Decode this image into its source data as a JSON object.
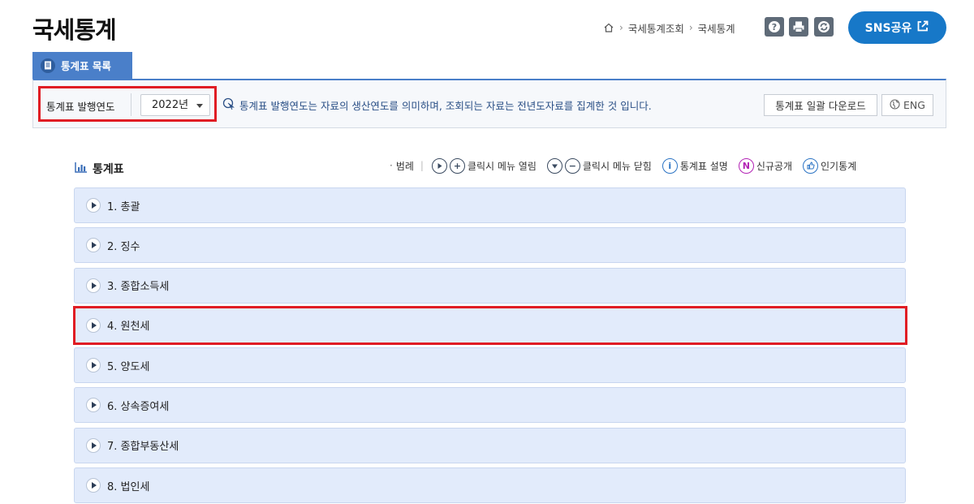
{
  "header": {
    "title": "국세통계",
    "breadcrumb": [
      "국세통계조회",
      "국세통계"
    ],
    "sns_label": "SNS공유"
  },
  "tab": {
    "label": "통계표 목록"
  },
  "filter": {
    "label": "통계표 발행연도",
    "year_value": "2022년",
    "info_text": "통계표 발행연도는 자료의 생산연도를 의미하며, 조회되는 자료는 전년도자료를 집계한 것 입니다.",
    "download_label": "통계표 일괄 다운로드",
    "eng_label": "ENG"
  },
  "section": {
    "title": "통계표"
  },
  "legend": {
    "title": "범례",
    "open_label": "클릭시 메뉴 열림",
    "close_label": "클릭시 메뉴 닫힘",
    "desc_label": "통계표 설명",
    "new_label": "신규공개",
    "popular_label": "인기통계"
  },
  "rows": [
    "1. 총괄",
    "2. 징수",
    "3. 종합소득세",
    "4. 원천세",
    "5. 양도세",
    "6. 상속증여세",
    "7. 종합부동산세",
    "8. 법인세"
  ],
  "colors": {
    "accent": "#1778c8",
    "tab": "#4a7fc9",
    "highlight": "#e01d24",
    "row_bg": "#e2ebfb"
  }
}
